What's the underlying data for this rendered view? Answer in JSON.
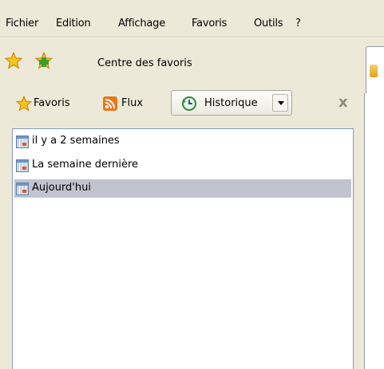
{
  "menu": {
    "items": [
      "Fichier",
      "Edition",
      "Affichage",
      "Favoris",
      "Outils",
      "?"
    ]
  },
  "favbar": {
    "center_label": "Centre des favoris"
  },
  "panel": {
    "favoris_label": "Favoris",
    "flux_label": "Flux",
    "historique_label": "Historique",
    "close_label": "x"
  },
  "history": {
    "items": [
      {
        "label": "il y a 2 semaines",
        "selected": false
      },
      {
        "label": "La semaine dernière",
        "selected": false
      },
      {
        "label": "Aujourd'hui",
        "selected": true
      }
    ]
  },
  "icons": {
    "favorites_star": "star-icon",
    "add_favorite": "add-favorite-star-icon",
    "flux": "rss-feed-icon",
    "history": "history-clock-icon",
    "day_folder": "calendar-icon"
  }
}
